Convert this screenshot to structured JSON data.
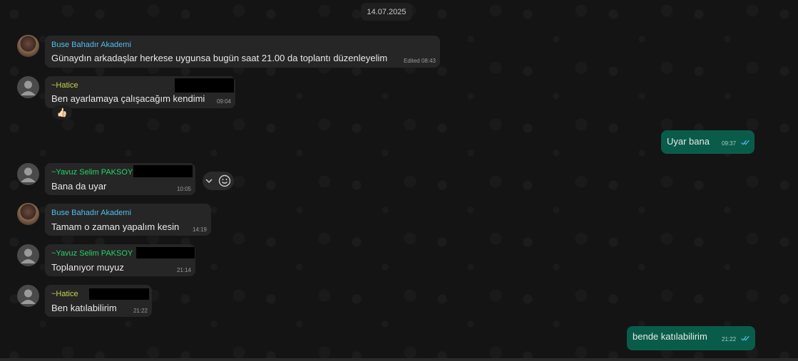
{
  "date_chip": "14.07.2025",
  "messages": [
    {
      "sender": "Buse Bahadır Akademi",
      "text": "Günaydın arkadaşlar herkese uygunsa bugün saat 21.00 da toplantı düzenleyelim",
      "time": "Edited 08:43"
    },
    {
      "sender": "~Hatice",
      "text": "Ben ayarlamaya çalışacağım kendimi",
      "time": "09:04",
      "reaction": "👍🏻"
    },
    {
      "text": "Uyar bana",
      "time": "09:37",
      "outgoing": true
    },
    {
      "sender": "~Yavuz Selim PAKSOY",
      "text": "Bana da uyar",
      "time": "10:05"
    },
    {
      "sender": "Buse Bahadır Akademi",
      "text": "Tamam o zaman yapalım kesin",
      "time": "14:19"
    },
    {
      "sender": "~Yavuz Selim PAKSOY",
      "text": "Toplanıyor muyuz",
      "time": "21:14"
    },
    {
      "sender": "~Hatice",
      "text": "Ben katılabilirim",
      "time": "21:22"
    },
    {
      "text": "bende katılabilirim",
      "time": "21:22",
      "outgoing": true
    }
  ],
  "colors": {
    "buse": "#53bdeb",
    "hatice": "#c9d34a",
    "yavuz": "#25d366",
    "incoming_bubble": "#262626",
    "outgoing_bubble": "#0a5c4a",
    "read_ticks": "#53bdeb"
  },
  "icons": {
    "hover_menu": "chevron-down-icon",
    "hover_react": "emoji-icon",
    "read_receipt": "double-check-icon"
  }
}
